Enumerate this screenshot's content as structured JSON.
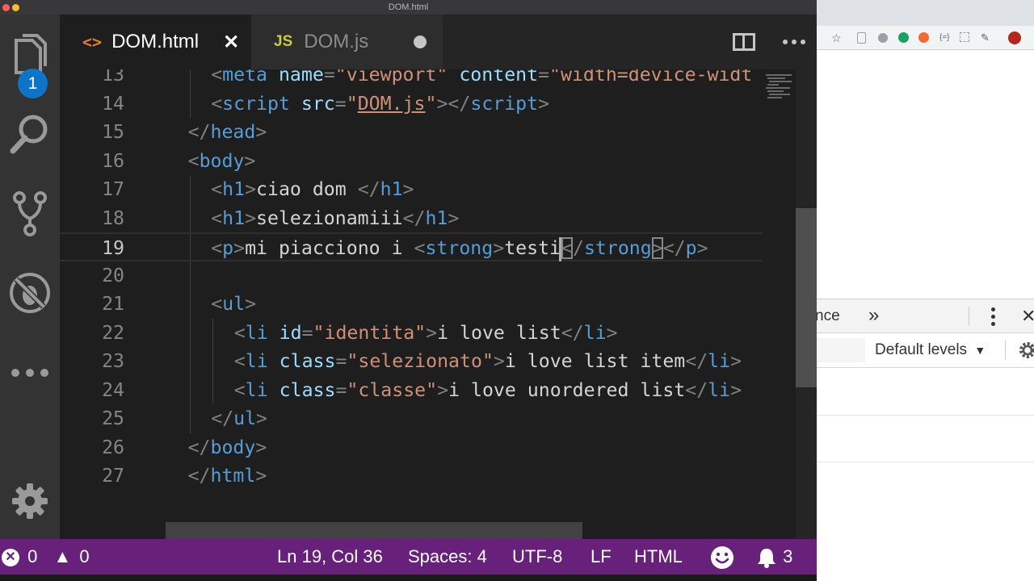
{
  "window": {
    "title": "DOM.html"
  },
  "activity_bar": {
    "explorer_badge": "1",
    "icons": [
      "files-icon",
      "search-icon",
      "source-control-icon",
      "debug-icon",
      "more-icon",
      "gear-icon"
    ]
  },
  "tabs": [
    {
      "label": "DOM.html",
      "icon": "<>",
      "state": "active",
      "close": "✕"
    },
    {
      "label": "DOM.js",
      "icon": "JS",
      "state": "modified"
    }
  ],
  "editor": {
    "current_line": 19,
    "lines": [
      {
        "n": "13",
        "tokens": [
          [
            "p",
            "<"
          ],
          [
            "g",
            "meta"
          ],
          [
            "a",
            " name"
          ],
          [
            "p",
            "="
          ],
          [
            "s",
            "\"viewport\""
          ],
          [
            "a",
            " content"
          ],
          [
            "p",
            "="
          ],
          [
            "s",
            "\"width=device-widt"
          ]
        ]
      },
      {
        "n": "14",
        "tokens": [
          [
            "p",
            "<"
          ],
          [
            "g",
            "script"
          ],
          [
            "a",
            " src"
          ],
          [
            "p",
            "="
          ],
          [
            "s",
            "\""
          ],
          [
            "l",
            "DOM.js"
          ],
          [
            "s",
            "\""
          ],
          [
            "p",
            "></"
          ],
          [
            "g",
            "script"
          ],
          [
            "p",
            ">"
          ]
        ]
      },
      {
        "n": "15",
        "tokens": [
          [
            "p",
            "</"
          ],
          [
            "g",
            "head"
          ],
          [
            "p",
            ">"
          ]
        ]
      },
      {
        "n": "16",
        "tokens": [
          [
            "p",
            "<"
          ],
          [
            "g",
            "body"
          ],
          [
            "p",
            ">"
          ]
        ]
      },
      {
        "n": "17",
        "tokens": [
          [
            "p",
            "<"
          ],
          [
            "g",
            "h1"
          ],
          [
            "p",
            ">"
          ],
          [
            "t",
            "ciao dom "
          ],
          [
            "p",
            "</"
          ],
          [
            "g",
            "h1"
          ],
          [
            "p",
            ">"
          ]
        ]
      },
      {
        "n": "18",
        "tokens": [
          [
            "p",
            "<"
          ],
          [
            "g",
            "h1"
          ],
          [
            "p",
            ">"
          ],
          [
            "t",
            "selezionamiii"
          ],
          [
            "p",
            "</"
          ],
          [
            "g",
            "h1"
          ],
          [
            "p",
            ">"
          ]
        ]
      },
      {
        "n": "19",
        "tokens": [
          [
            "p",
            "<"
          ],
          [
            "g",
            "p"
          ],
          [
            "p",
            ">"
          ],
          [
            "t",
            "mi piacciono i "
          ],
          [
            "p",
            "<"
          ],
          [
            "g",
            "strong"
          ],
          [
            "p",
            ">"
          ],
          [
            "t",
            "testi"
          ],
          [
            "c",
            ""
          ],
          [
            "b",
            "<"
          ],
          [
            "p",
            "/"
          ],
          [
            "g",
            "strong"
          ],
          [
            "b",
            ">"
          ],
          [
            "p",
            "</"
          ],
          [
            "g",
            "p"
          ],
          [
            "p",
            ">"
          ]
        ]
      },
      {
        "n": "20",
        "tokens": []
      },
      {
        "n": "21",
        "tokens": [
          [
            "p",
            "<"
          ],
          [
            "g",
            "ul"
          ],
          [
            "p",
            ">"
          ]
        ]
      },
      {
        "n": "22",
        "tokens": [
          [
            "p",
            "<"
          ],
          [
            "g",
            "li"
          ],
          [
            "a",
            " id"
          ],
          [
            "p",
            "="
          ],
          [
            "s",
            "\"identita\""
          ],
          [
            "p",
            ">"
          ],
          [
            "t",
            "i love list"
          ],
          [
            "p",
            "</"
          ],
          [
            "g",
            "li"
          ],
          [
            "p",
            ">"
          ]
        ]
      },
      {
        "n": "23",
        "tokens": [
          [
            "p",
            "<"
          ],
          [
            "g",
            "li"
          ],
          [
            "a",
            " class"
          ],
          [
            "p",
            "="
          ],
          [
            "s",
            "\"selezionato\""
          ],
          [
            "p",
            ">"
          ],
          [
            "t",
            "i love list item"
          ],
          [
            "p",
            "</"
          ],
          [
            "g",
            "li"
          ],
          [
            "p",
            ">"
          ]
        ]
      },
      {
        "n": "24",
        "tokens": [
          [
            "p",
            "<"
          ],
          [
            "g",
            "li"
          ],
          [
            "a",
            " class"
          ],
          [
            "p",
            "="
          ],
          [
            "s",
            "\"classe\""
          ],
          [
            "p",
            ">"
          ],
          [
            "t",
            "i love unordered list"
          ],
          [
            "p",
            "</"
          ],
          [
            "g",
            "li"
          ],
          [
            "p",
            ">"
          ]
        ]
      },
      {
        "n": "25",
        "tokens": [
          [
            "p",
            "</"
          ],
          [
            "g",
            "ul"
          ],
          [
            "p",
            ">"
          ]
        ]
      },
      {
        "n": "26",
        "tokens": [
          [
            "p",
            "</"
          ],
          [
            "g",
            "body"
          ],
          [
            "p",
            ">"
          ]
        ]
      },
      {
        "n": "27",
        "tokens": [
          [
            "p",
            "</"
          ],
          [
            "g",
            "html"
          ],
          [
            "p",
            ">"
          ]
        ]
      }
    ],
    "indents": [
      2,
      2,
      1,
      1,
      2,
      2,
      2,
      0,
      2,
      3,
      3,
      3,
      2,
      1,
      1
    ]
  },
  "status_bar": {
    "errors": "0",
    "warnings": "0",
    "position": "Ln 19, Col 36",
    "spaces": "Spaces: 4",
    "encoding": "UTF-8",
    "eol": "LF",
    "language": "HTML",
    "notifications": "3"
  },
  "browser": {
    "devtools_tab_partial": "nce",
    "overflow": "»",
    "levels_label": "Default levels",
    "levels_arrow": "▼"
  },
  "colors": {
    "status_bar": "#68217a",
    "tag": "#569cd6",
    "attribute": "#9cdcfe",
    "string": "#ce9178",
    "text": "#d4d4d4",
    "punctuation": "#808080"
  }
}
